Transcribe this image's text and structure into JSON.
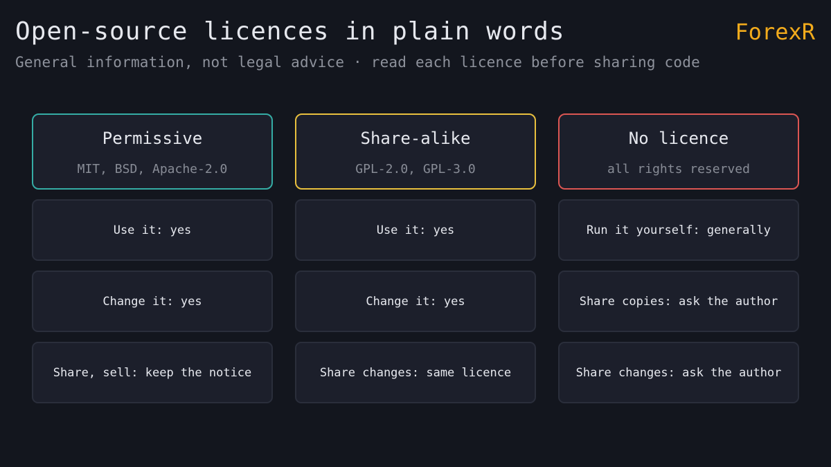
{
  "header": {
    "title": "Open-source licences in plain words",
    "subtitle": "General information, not legal advice · read each licence before sharing code",
    "brand": "ForexR"
  },
  "columns": [
    {
      "name": "Permissive",
      "examples": "MIT, BSD, Apache-2.0",
      "accent_color": "#35aca5",
      "rows": [
        "Use it: yes",
        "Change it: yes",
        "Share, sell: keep the notice"
      ]
    },
    {
      "name": "Share-alike",
      "examples": "GPL-2.0, GPL-3.0",
      "accent_color": "#e9c03e",
      "rows": [
        "Use it: yes",
        "Change it: yes",
        "Share changes: same licence"
      ]
    },
    {
      "name": "No licence",
      "examples": "all rights reserved",
      "accent_color": "#dc5653",
      "rows": [
        "Run it yourself: generally",
        "Share copies: ask the author",
        "Share changes: ask the author"
      ]
    }
  ],
  "colors": {
    "background": "#13161e",
    "brand": "#f2ab1c"
  }
}
